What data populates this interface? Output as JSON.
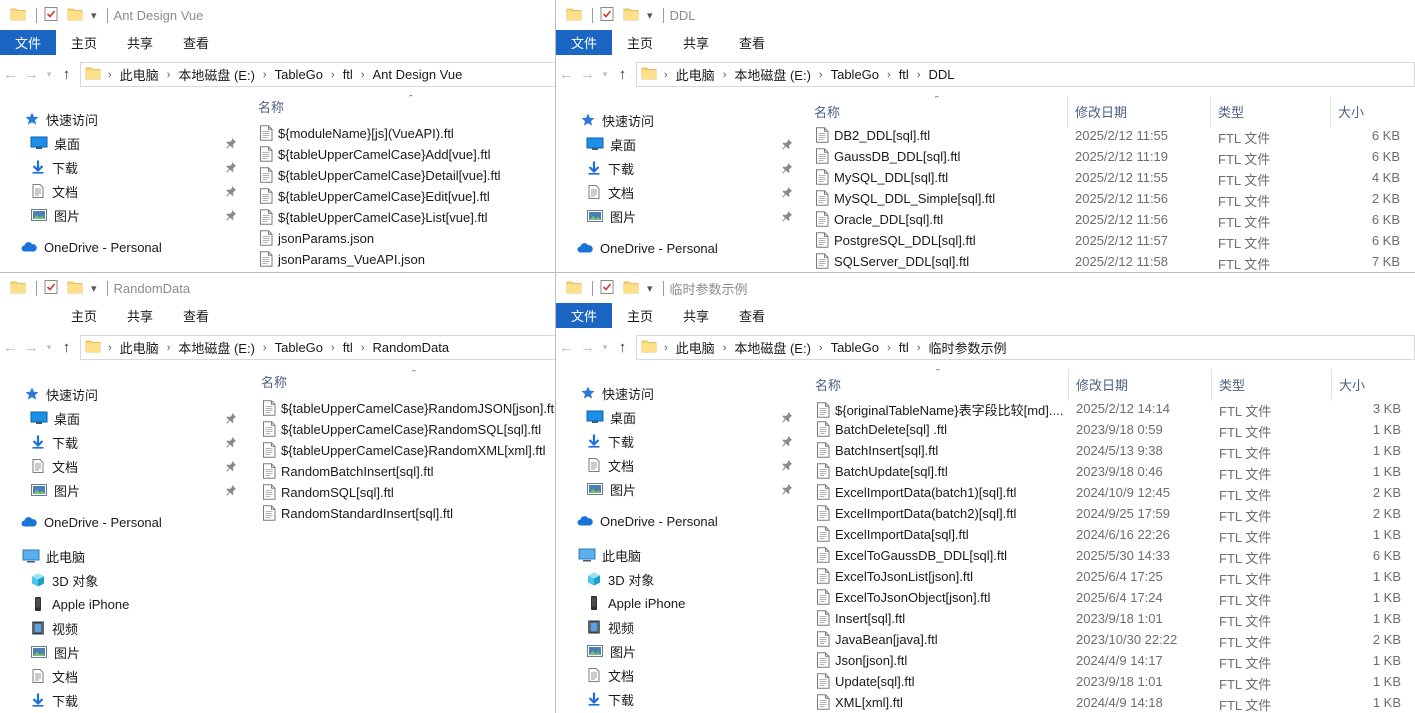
{
  "win1": {
    "title": "Ant Design Vue",
    "tabs": {
      "file": "文件",
      "home": "主页",
      "share": "共享",
      "view": "查看"
    },
    "path": [
      "此电脑",
      "本地磁盘 (E:)",
      "TableGo",
      "ftl",
      "Ant Design Vue"
    ],
    "nav": [
      {
        "label": "快速访问",
        "icon": "star-icon"
      },
      {
        "label": "桌面",
        "icon": "desktop-icon"
      },
      {
        "label": "下载",
        "icon": "download-icon"
      },
      {
        "label": "文档",
        "icon": "document-icon"
      },
      {
        "label": "图片",
        "icon": "picture-icon"
      },
      {
        "label": "OneDrive - Personal",
        "icon": "cloud-icon"
      }
    ],
    "col_name": "名称",
    "files": [
      "${moduleName}[js](VueAPI).ftl",
      "${tableUpperCamelCase}Add[vue].ftl",
      "${tableUpperCamelCase}Detail[vue].ftl",
      "${tableUpperCamelCase}Edit[vue].ftl",
      "${tableUpperCamelCase}List[vue].ftl",
      "jsonParams.json",
      "jsonParams_VueAPI.json"
    ]
  },
  "win2": {
    "title": "DDL",
    "tabs": {
      "file": "文件",
      "home": "主页",
      "share": "共享",
      "view": "查看"
    },
    "path": [
      "此电脑",
      "本地磁盘 (E:)",
      "TableGo",
      "ftl",
      "DDL"
    ],
    "nav": [
      {
        "label": "快速访问"
      },
      {
        "label": "桌面"
      },
      {
        "label": "下载"
      },
      {
        "label": "文档"
      },
      {
        "label": "图片"
      },
      {
        "label": "OneDrive - Personal"
      }
    ],
    "cols": {
      "name": "名称",
      "date": "修改日期",
      "type": "类型",
      "size": "大小"
    },
    "files": [
      {
        "name": "DB2_DDL[sql].ftl",
        "date": "2025/2/12 11:55",
        "type": "FTL 文件",
        "size": "6 KB"
      },
      {
        "name": "GaussDB_DDL[sql].ftl",
        "date": "2025/2/12 11:19",
        "type": "FTL 文件",
        "size": "6 KB"
      },
      {
        "name": "MySQL_DDL[sql].ftl",
        "date": "2025/2/12 11:55",
        "type": "FTL 文件",
        "size": "4 KB"
      },
      {
        "name": "MySQL_DDL_Simple[sql].ftl",
        "date": "2025/2/12 11:56",
        "type": "FTL 文件",
        "size": "2 KB"
      },
      {
        "name": "Oracle_DDL[sql].ftl",
        "date": "2025/2/12 11:56",
        "type": "FTL 文件",
        "size": "6 KB"
      },
      {
        "name": "PostgreSQL_DDL[sql].ftl",
        "date": "2025/2/12 11:57",
        "type": "FTL 文件",
        "size": "6 KB"
      },
      {
        "name": "SQLServer_DDL[sql].ftl",
        "date": "2025/2/12 11:58",
        "type": "FTL 文件",
        "size": "7 KB"
      }
    ]
  },
  "win3": {
    "title": "RandomData",
    "tabs": {
      "home": "主页",
      "share": "共享",
      "view": "查看"
    },
    "path": [
      "此电脑",
      "本地磁盘 (E:)",
      "TableGo",
      "ftl",
      "RandomData"
    ],
    "nav": [
      {
        "label": "快速访问"
      },
      {
        "label": "桌面"
      },
      {
        "label": "下载"
      },
      {
        "label": "文档"
      },
      {
        "label": "图片"
      },
      {
        "label": "OneDrive - Personal"
      },
      {
        "label": "此电脑"
      },
      {
        "label": "3D 对象"
      },
      {
        "label": "Apple iPhone"
      },
      {
        "label": "视频"
      },
      {
        "label": "图片"
      },
      {
        "label": "文档"
      },
      {
        "label": "下载"
      }
    ],
    "col_name": "名称",
    "files": [
      "${tableUpperCamelCase}RandomJSON[json].ftl",
      "${tableUpperCamelCase}RandomSQL[sql].ftl",
      "${tableUpperCamelCase}RandomXML[xml].ftl",
      "RandomBatchInsert[sql].ftl",
      "RandomSQL[sql].ftl",
      "RandomStandardInsert[sql].ftl"
    ]
  },
  "win4": {
    "title": "临时参数示例",
    "tabs": {
      "file": "文件",
      "home": "主页",
      "share": "共享",
      "view": "查看"
    },
    "path": [
      "此电脑",
      "本地磁盘 (E:)",
      "TableGo",
      "ftl",
      "临时参数示例"
    ],
    "nav": [
      {
        "label": "快速访问"
      },
      {
        "label": "桌面"
      },
      {
        "label": "下载"
      },
      {
        "label": "文档"
      },
      {
        "label": "图片"
      },
      {
        "label": "OneDrive - Personal"
      },
      {
        "label": "此电脑"
      },
      {
        "label": "3D 对象"
      },
      {
        "label": "Apple iPhone"
      },
      {
        "label": "视频"
      },
      {
        "label": "图片"
      },
      {
        "label": "文档"
      },
      {
        "label": "下载"
      }
    ],
    "cols": {
      "name": "名称",
      "date": "修改日期",
      "type": "类型",
      "size": "大小"
    },
    "files": [
      {
        "name": "${originalTableName}表字段比较[md]....",
        "date": "2025/2/12 14:14",
        "type": "FTL 文件",
        "size": "3 KB"
      },
      {
        "name": "BatchDelete[sql] .ftl",
        "date": "2023/9/18 0:59",
        "type": "FTL 文件",
        "size": "1 KB"
      },
      {
        "name": "BatchInsert[sql].ftl",
        "date": "2024/5/13 9:38",
        "type": "FTL 文件",
        "size": "1 KB"
      },
      {
        "name": "BatchUpdate[sql].ftl",
        "date": "2023/9/18 0:46",
        "type": "FTL 文件",
        "size": "1 KB"
      },
      {
        "name": "ExcelImportData(batch1)[sql].ftl",
        "date": "2024/10/9 12:45",
        "type": "FTL 文件",
        "size": "2 KB"
      },
      {
        "name": "ExcelImportData(batch2)[sql].ftl",
        "date": "2024/9/25 17:59",
        "type": "FTL 文件",
        "size": "2 KB"
      },
      {
        "name": "ExcelImportData[sql].ftl",
        "date": "2024/6/16 22:26",
        "type": "FTL 文件",
        "size": "1 KB"
      },
      {
        "name": "ExcelToGaussDB_DDL[sql].ftl",
        "date": "2025/5/30 14:33",
        "type": "FTL 文件",
        "size": "6 KB"
      },
      {
        "name": "ExcelToJsonList[json].ftl",
        "date": "2025/6/4 17:25",
        "type": "FTL 文件",
        "size": "1 KB"
      },
      {
        "name": "ExcelToJsonObject[json].ftl",
        "date": "2025/6/4 17:24",
        "type": "FTL 文件",
        "size": "1 KB"
      },
      {
        "name": "Insert[sql].ftl",
        "date": "2023/9/18 1:01",
        "type": "FTL 文件",
        "size": "1 KB"
      },
      {
        "name": "JavaBean[java].ftl",
        "date": "2023/10/30 22:22",
        "type": "FTL 文件",
        "size": "2 KB"
      },
      {
        "name": "Json[json].ftl",
        "date": "2024/4/9 14:17",
        "type": "FTL 文件",
        "size": "1 KB"
      },
      {
        "name": "Update[sql].ftl",
        "date": "2023/9/18 1:01",
        "type": "FTL 文件",
        "size": "1 KB"
      },
      {
        "name": "XML[xml].ftl",
        "date": "2024/4/9 14:18",
        "type": "FTL 文件",
        "size": "1 KB"
      }
    ]
  }
}
